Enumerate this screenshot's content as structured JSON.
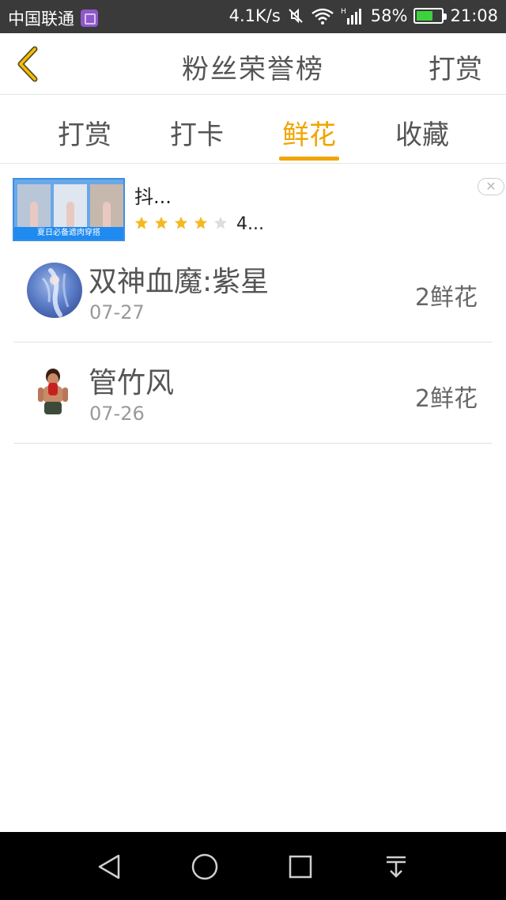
{
  "status_bar": {
    "carrier": "中国联通",
    "net_speed": "4.1K/s",
    "battery_pct": "58%",
    "time": "21:08",
    "signal_type": "H"
  },
  "header": {
    "title": "粉丝荣誉榜",
    "action": "打赏"
  },
  "tabs": [
    {
      "label": "打赏"
    },
    {
      "label": "打卡"
    },
    {
      "label": "鲜花"
    },
    {
      "label": "收藏"
    }
  ],
  "active_tab": "鲜花",
  "ad": {
    "title": "抖...",
    "rating_text": "4...",
    "stars": 4,
    "thumb_caption": "夏日必备遮肉穿搭",
    "close_glyph": "✕"
  },
  "list": [
    {
      "name": "双神血魔:紫星",
      "date": "07-27",
      "value": "2鲜花"
    },
    {
      "name": "管竹风",
      "date": "07-26",
      "value": "2鲜花"
    }
  ],
  "colors": {
    "accent": "#f0a500",
    "status_bar_bg": "#3a3a3a",
    "nav_bar_bg": "#000000",
    "battery_fill": "#3dd13d",
    "ad_border": "#3b8fe5"
  }
}
